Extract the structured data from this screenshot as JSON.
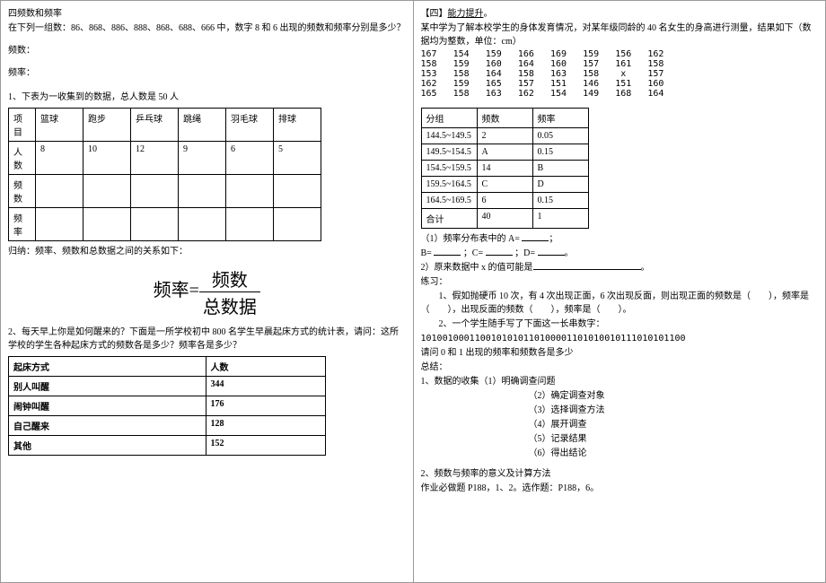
{
  "left": {
    "title": "四频数和频率",
    "q": "在下列一组数：86、868、886、888、868、688、666 中，数字 8 和 6 出现的频数和频率分别是多少？",
    "freq_count_label": "频数：",
    "freq_rate_label": "频率：",
    "table_intro": "1、下表为一收集到的数据，总人数是 50 人",
    "tbl1": {
      "row_labels": [
        "项目",
        "人数",
        "频数",
        "频率"
      ],
      "cols": [
        "篮球",
        "跑步",
        "乒乓球",
        "跳绳",
        "羽毛球",
        "排球"
      ],
      "counts": [
        "8",
        "10",
        "12",
        "9",
        "6",
        "5"
      ]
    },
    "guina": "归纳：频率、频数和总数据之间的关系如下：",
    "formula_lhs": "频率=",
    "formula_num": "频数",
    "formula_den": "总数据",
    "q2": "2、每天早上你是如何醒来的？下面是一所学校初中 800 名学生早晨起床方式的统计表，请问：这所学校的学生各种起床方式的频数各是多少？频率各是多少？",
    "tbl2": {
      "headers": [
        "起床方式",
        "人数"
      ],
      "rows": [
        [
          "别人叫醒",
          "344"
        ],
        [
          "闹钟叫醒",
          "176"
        ],
        [
          "自己醒来",
          "128"
        ],
        [
          "其他",
          "152"
        ]
      ]
    }
  },
  "right": {
    "section": "【四】",
    "section_title": "能力提升",
    "intro": "某中学为了解本校学生的身体发育情况，对某年级同龄的 40 名女生的身高进行测量，结果如下（数据均为整数，单位：cm）",
    "data_rows": [
      "167   154   159   166   169   159   156   162",
      "158   159   160   164   160   157   161   158",
      "153   158   164   158   163   158    x    157",
      "162   159   165   157   151   146   151   160",
      "165   158   163   162   154   149   168   164"
    ],
    "tbl3": {
      "headers": [
        "分组",
        "频数",
        "频率"
      ],
      "rows": [
        [
          "144.5~149.5",
          "2",
          "0.05"
        ],
        [
          "149.5~154.5",
          "A",
          "0.15"
        ],
        [
          "154.5~159.5",
          "14",
          "B"
        ],
        [
          "159.5~164.5",
          "C",
          "D"
        ],
        [
          "164.5~169.5",
          "6",
          "0.15"
        ],
        [
          "合计",
          "40",
          "1"
        ]
      ]
    },
    "q1a": "（1）频率分布表中的 A= ",
    "q1b": "B= ",
    "q1c": "；C= ",
    "q1d": "；D= ",
    "semicolon": "；",
    "period": "。",
    "q2": "2）原来数据中 x 的值可能是",
    "lianxi": "练习：",
    "ex1": "1、假如抛硬币 10 次，有 4 次出现正面，6 次出现反面，则出现正面的频数是（　　），频率是（　　），出现反面的频数（　　），频率是（　　）。",
    "ex2": "2、一个学生随手写了下面这一长串数字：",
    "digits": "1010010001100101010110100001101010010111010101100",
    "ex2q": "请问 0 和 1 出现的频率和频数各是多少",
    "zongjie": "总结：",
    "s1": "1、数据的收集（1）明确调查问题",
    "s1_2": "（2）确定调查对象",
    "s1_3": "（3）选择调查方法",
    "s1_4": "（4）展开调查",
    "s1_5": "（5）记录结果",
    "s1_6": "（6）得出结论",
    "s2": "2、频数与频率的意义及计算方法",
    "hw": "作业必做题 P188，1、2。选作题：P188，6。"
  }
}
